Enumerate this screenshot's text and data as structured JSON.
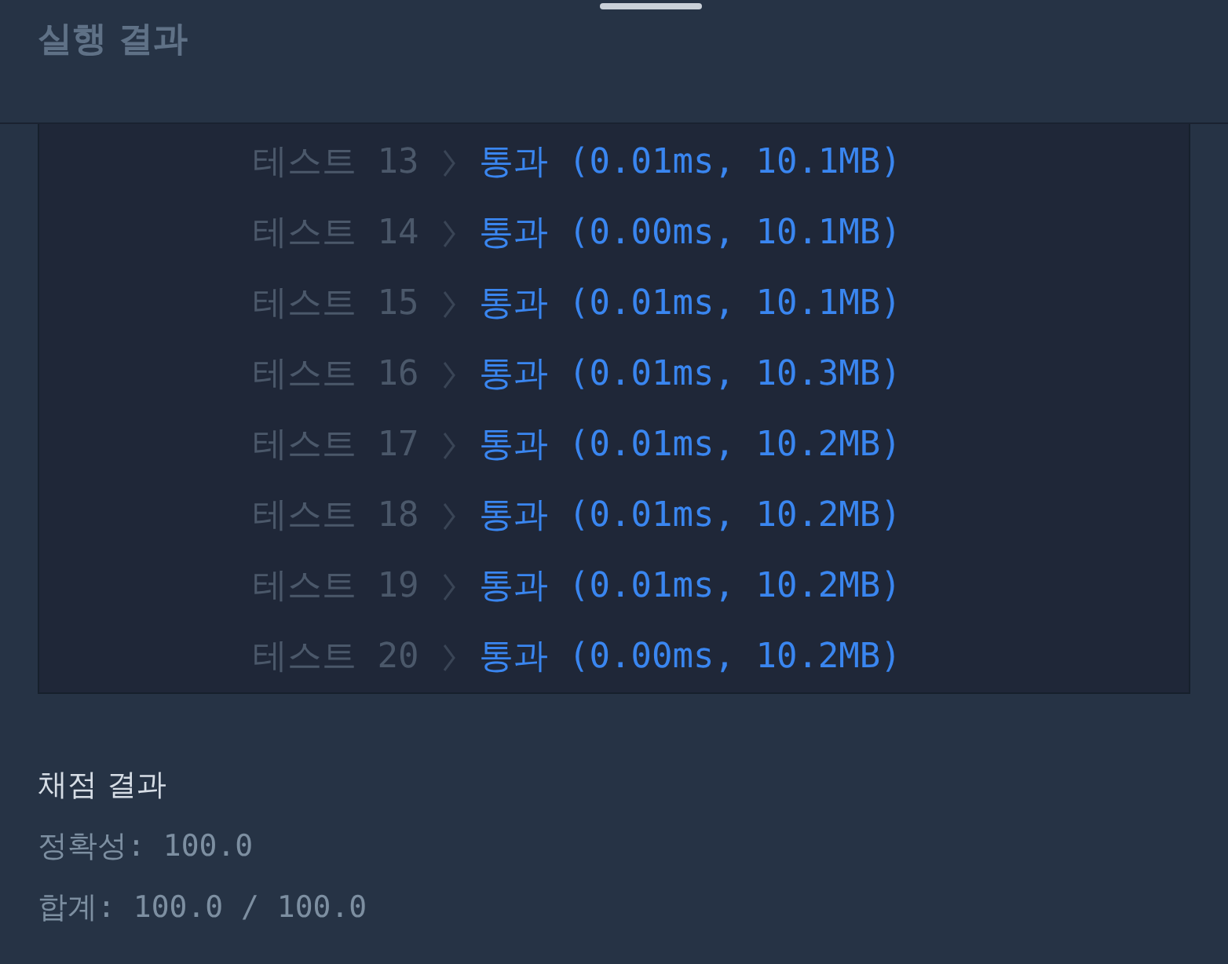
{
  "header": {
    "title": "실행 결과"
  },
  "tests": [
    {
      "label": "테스트 13",
      "result": "통과 (0.01ms, 10.1MB)"
    },
    {
      "label": "테스트 14",
      "result": "통과 (0.00ms, 10.1MB)"
    },
    {
      "label": "테스트 15",
      "result": "통과 (0.01ms, 10.1MB)"
    },
    {
      "label": "테스트 16",
      "result": "통과 (0.01ms, 10.3MB)"
    },
    {
      "label": "테스트 17",
      "result": "통과 (0.01ms, 10.2MB)"
    },
    {
      "label": "테스트 18",
      "result": "통과 (0.01ms, 10.2MB)"
    },
    {
      "label": "테스트 19",
      "result": "통과 (0.01ms, 10.2MB)"
    },
    {
      "label": "테스트 20",
      "result": "통과 (0.00ms, 10.2MB)"
    }
  ],
  "grading": {
    "title": "채점 결과",
    "lines": [
      "정확성: 100.0",
      "합계: 100.0 / 100.0"
    ]
  }
}
